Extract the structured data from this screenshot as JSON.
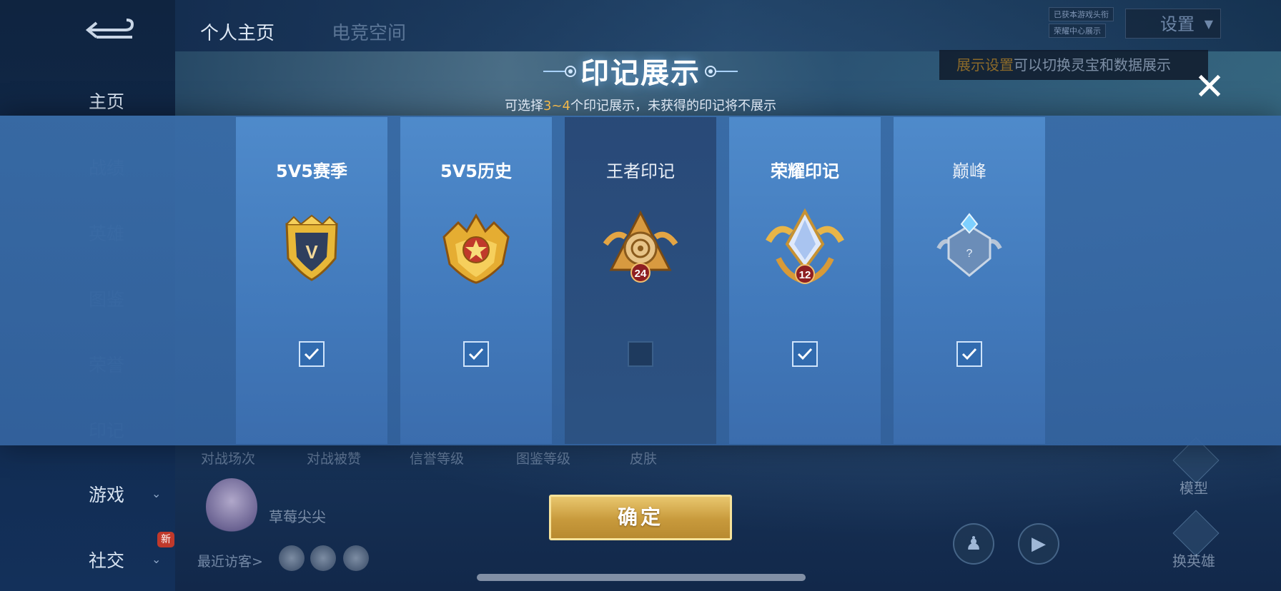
{
  "background": {
    "tabs": [
      {
        "label": "个人主页",
        "active": true
      },
      {
        "label": "电竞空间",
        "active": false
      }
    ],
    "nav": [
      {
        "label": "主页",
        "active": true
      },
      {
        "label": "战绩",
        "dim": true
      },
      {
        "label": "英雄",
        "dim": true
      },
      {
        "label": "图鉴",
        "dim": true
      },
      {
        "label": "荣誉",
        "dim": true
      },
      {
        "label": "印记",
        "dim": true
      },
      {
        "label": "游戏",
        "dim": false,
        "has_chevron": true
      },
      {
        "label": "社交",
        "dim": false,
        "has_chevron": true,
        "badge": "新"
      }
    ],
    "settings_label": "设置",
    "top_tags": [
      "已获本游戏头衔",
      "荣耀中心展示"
    ],
    "tooltip_highlight": "展示设置",
    "tooltip_rest": "可以切换灵宝和数据展示",
    "stats_labels": [
      "对战场次",
      "对战被赞",
      "信誉等级",
      "图鉴等级",
      "皮肤"
    ],
    "player_name": "草莓尖尖",
    "recent_visitors_label": "最近访客>",
    "right_actions": [
      {
        "label": "模型",
        "icon": "model-icon"
      },
      {
        "label": "换英雄",
        "icon": "swap-hero-icon"
      }
    ]
  },
  "modal": {
    "title": "印记展示",
    "subtitle_prefix": "可选择",
    "subtitle_highlight": "3~4",
    "subtitle_suffix": "个印记展示，未获得的印记将不展示",
    "close_icon": "close-icon",
    "cards": [
      {
        "title": "5V5赛季",
        "emblem": "season-shield-emblem-icon",
        "emblem_text": "V",
        "checked": true,
        "dark": false
      },
      {
        "title": "5V5历史",
        "emblem": "history-star-crown-emblem-icon",
        "emblem_text": "",
        "checked": true,
        "dark": false
      },
      {
        "title": "王者印记",
        "emblem": "king-mark-emblem-icon",
        "emblem_text": "24",
        "checked": false,
        "dark": true
      },
      {
        "title": "荣耀印记",
        "emblem": "glory-mark-emblem-icon",
        "emblem_text": "12",
        "checked": true,
        "dark": false
      },
      {
        "title": "巅峰",
        "emblem": "peak-emblem-icon",
        "emblem_text": "?",
        "checked": true,
        "dark": false
      }
    ],
    "confirm_label": "确定"
  },
  "colors": {
    "accent_gold": "#f2b84a",
    "modal_blue": "#3a6eaa",
    "checkbox_border": "#cfe4fb"
  }
}
